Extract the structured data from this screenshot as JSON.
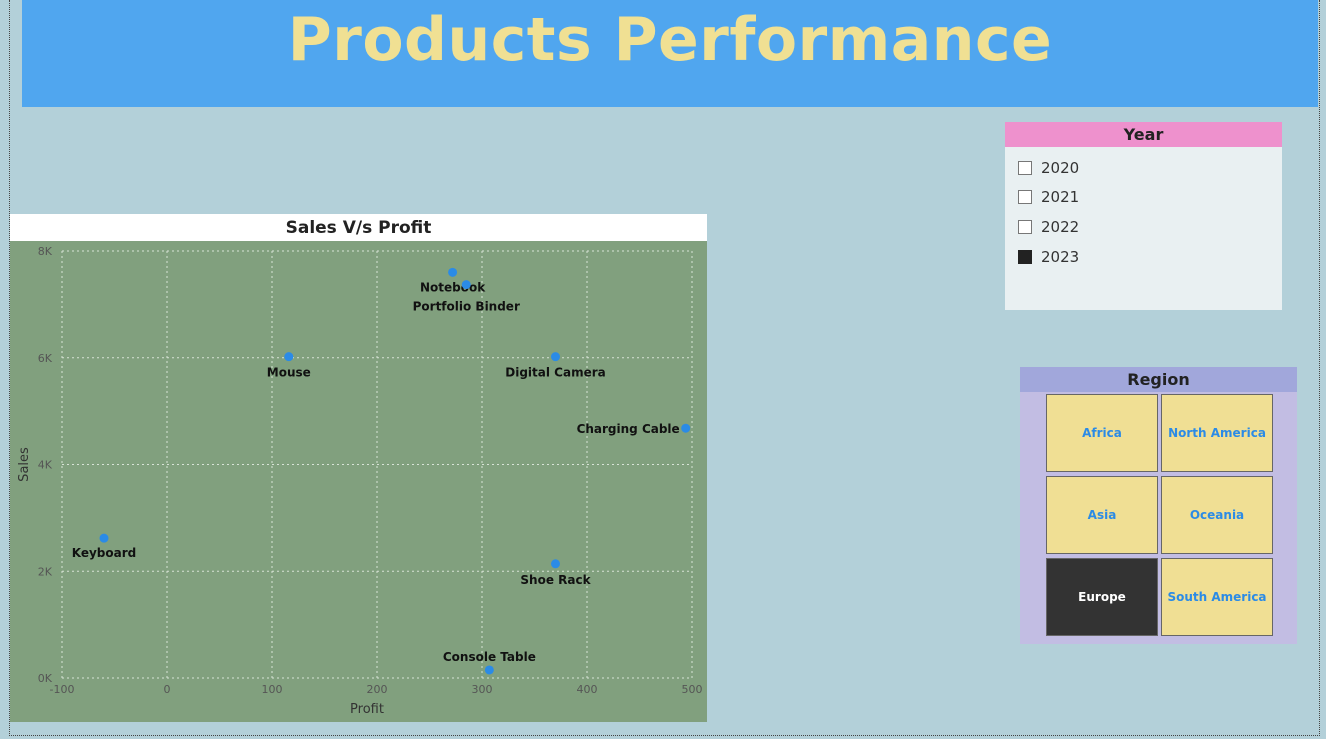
{
  "header": {
    "title": "Products Performance"
  },
  "year_slicer": {
    "title": "Year",
    "options": [
      {
        "label": "2020",
        "checked": false
      },
      {
        "label": "2021",
        "checked": false
      },
      {
        "label": "2022",
        "checked": false
      },
      {
        "label": "2023",
        "checked": true
      }
    ]
  },
  "region_slicer": {
    "title": "Region",
    "options": [
      {
        "label": "Africa",
        "selected": false
      },
      {
        "label": "North America",
        "selected": false
      },
      {
        "label": "Asia",
        "selected": false
      },
      {
        "label": "Oceania",
        "selected": false
      },
      {
        "label": "Europe",
        "selected": true
      },
      {
        "label": "South America",
        "selected": false
      }
    ]
  },
  "chart_data": {
    "type": "scatter",
    "title": "Sales V/s Profit",
    "xlabel": "Profit",
    "ylabel": "Sales",
    "xlim": [
      -100,
      500
    ],
    "ylim": [
      0,
      8000
    ],
    "x_ticks": [
      -100,
      0,
      100,
      200,
      300,
      400,
      500
    ],
    "y_ticks": [
      0,
      2000,
      4000,
      6000,
      8000
    ],
    "x_tick_labels": [
      "-100",
      "0",
      "100",
      "200",
      "300",
      "400",
      "500"
    ],
    "y_tick_labels": [
      "0K",
      "2K",
      "4K",
      "6K",
      "8K"
    ],
    "grid": true,
    "point_color": "#2b8be6",
    "points": [
      {
        "label": "Notebook",
        "x": 272,
        "y": 7600
      },
      {
        "label": "Portfolio Binder",
        "x": 285,
        "y": 7370
      },
      {
        "label": "Mouse",
        "x": 116,
        "y": 6020
      },
      {
        "label": "Digital Camera",
        "x": 370,
        "y": 6020
      },
      {
        "label": "Charging Cable",
        "x": 494,
        "y": 4680
      },
      {
        "label": "Keyboard",
        "x": -60,
        "y": 2620
      },
      {
        "label": "Shoe Rack",
        "x": 370,
        "y": 2140
      },
      {
        "label": "Console Table",
        "x": 307,
        "y": 150
      }
    ]
  }
}
